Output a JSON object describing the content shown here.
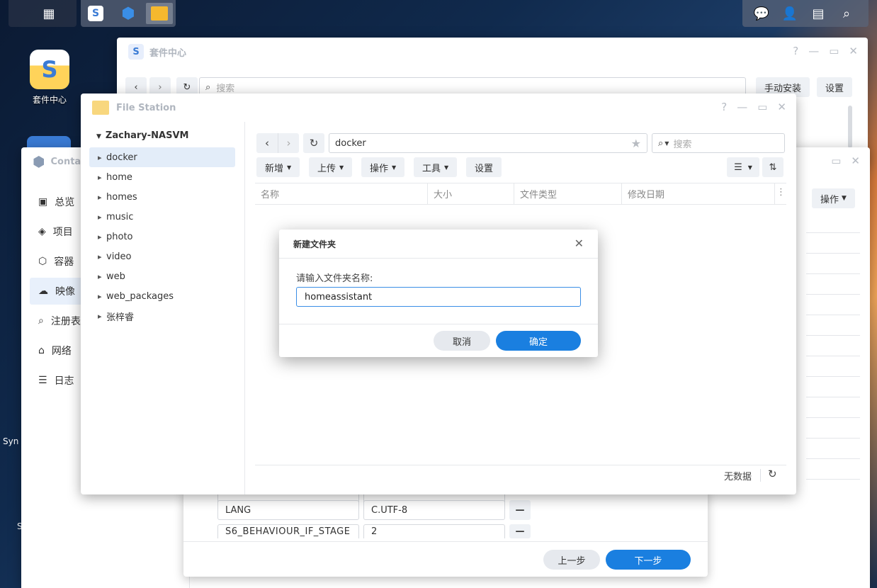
{
  "desktop": {
    "icons": [
      {
        "label": "套件中心"
      }
    ],
    "side_text_1": "Syn",
    "side_text_2": "S"
  },
  "taskbar": {
    "apps": [
      "package-center",
      "container-manager",
      "file-station"
    ]
  },
  "package_center": {
    "title": "套件中心",
    "search_placeholder": "搜索",
    "manual_install": "手动安装",
    "settings": "设置"
  },
  "container_manager": {
    "title": "Conta",
    "sidebar": [
      {
        "label": "总览"
      },
      {
        "label": "项目"
      },
      {
        "label": "容器"
      },
      {
        "label": "映像"
      },
      {
        "label": "注册表"
      },
      {
        "label": "网络"
      },
      {
        "label": "日志"
      }
    ],
    "action_button": "操作"
  },
  "wizard": {
    "env": [
      {
        "key": "LANG",
        "value": "C.UTF-8"
      },
      {
        "key": "S6_BEHAVIOUR_IF_STAGE",
        "value": "2"
      }
    ],
    "prev": "上一步",
    "next": "下一步"
  },
  "file_station": {
    "title": "File Station",
    "root": "Zachary-NASVM",
    "folders": [
      "docker",
      "home",
      "homes",
      "music",
      "photo",
      "video",
      "web",
      "web_packages",
      "张梓睿"
    ],
    "path": "docker",
    "search_placeholder": "搜索",
    "toolbar": {
      "create": "新增",
      "upload": "上传",
      "action": "操作",
      "tools": "工具",
      "settings": "设置"
    },
    "columns": [
      "名称",
      "大小",
      "文件类型",
      "修改日期"
    ],
    "status": "无数据"
  },
  "dialog": {
    "title": "新建文件夹",
    "label": "请输入文件夹名称:",
    "value": "homeassistant",
    "cancel": "取消",
    "ok": "确定"
  }
}
